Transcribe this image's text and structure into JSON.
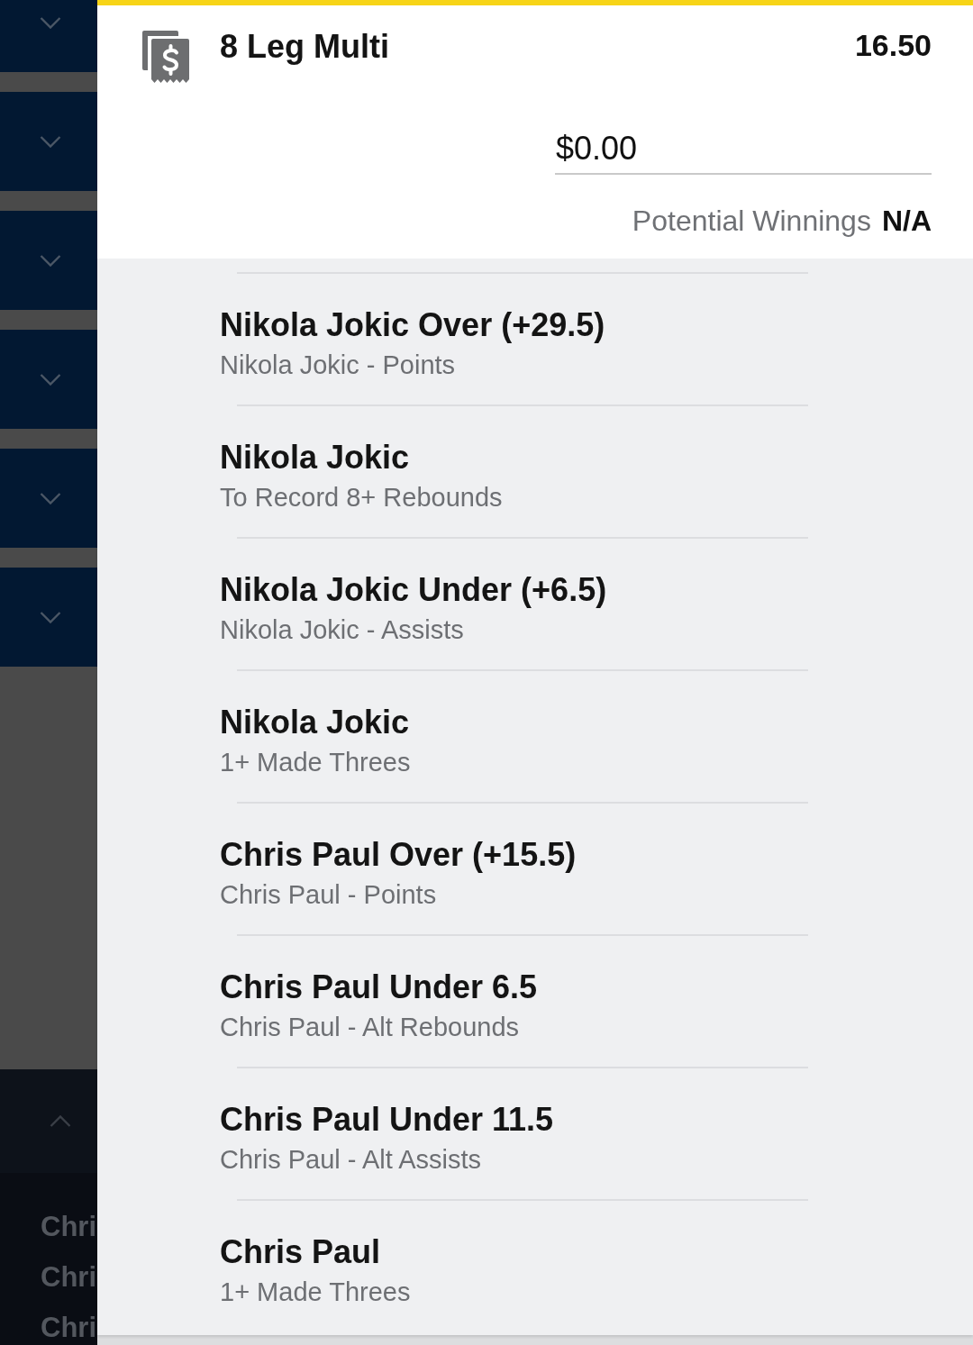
{
  "sidebar": {
    "sections": [
      {
        "expanded": false
      },
      {
        "expanded": false
      },
      {
        "expanded": false
      },
      {
        "expanded": false
      },
      {
        "expanded": false
      },
      {
        "expanded": false
      },
      {
        "expanded": true,
        "items": [
          "Chri",
          "Chri",
          "Chri"
        ]
      }
    ]
  },
  "bet_slip": {
    "title": "8 Leg Multi",
    "odds": "16.50",
    "stake": {
      "value": "$0.00"
    },
    "potential_winnings": {
      "label": "Potential Winnings",
      "value": "N/A"
    },
    "legs": [
      {
        "selection": "Nikola Jokic Over (+29.5)",
        "market": "Nikola Jokic - Points"
      },
      {
        "selection": "Nikola Jokic",
        "market": "To Record 8+ Rebounds"
      },
      {
        "selection": "Nikola Jokic Under (+6.5)",
        "market": "Nikola Jokic - Assists"
      },
      {
        "selection": "Nikola Jokic",
        "market": "1+ Made Threes"
      },
      {
        "selection": "Chris Paul Over (+15.5)",
        "market": "Chris Paul - Points"
      },
      {
        "selection": "Chris Paul Under 6.5",
        "market": "Chris Paul - Alt Rebounds"
      },
      {
        "selection": "Chris Paul Under 11.5",
        "market": "Chris Paul - Alt Assists"
      },
      {
        "selection": "Chris Paul",
        "market": "1+ Made Threes"
      }
    ]
  }
}
